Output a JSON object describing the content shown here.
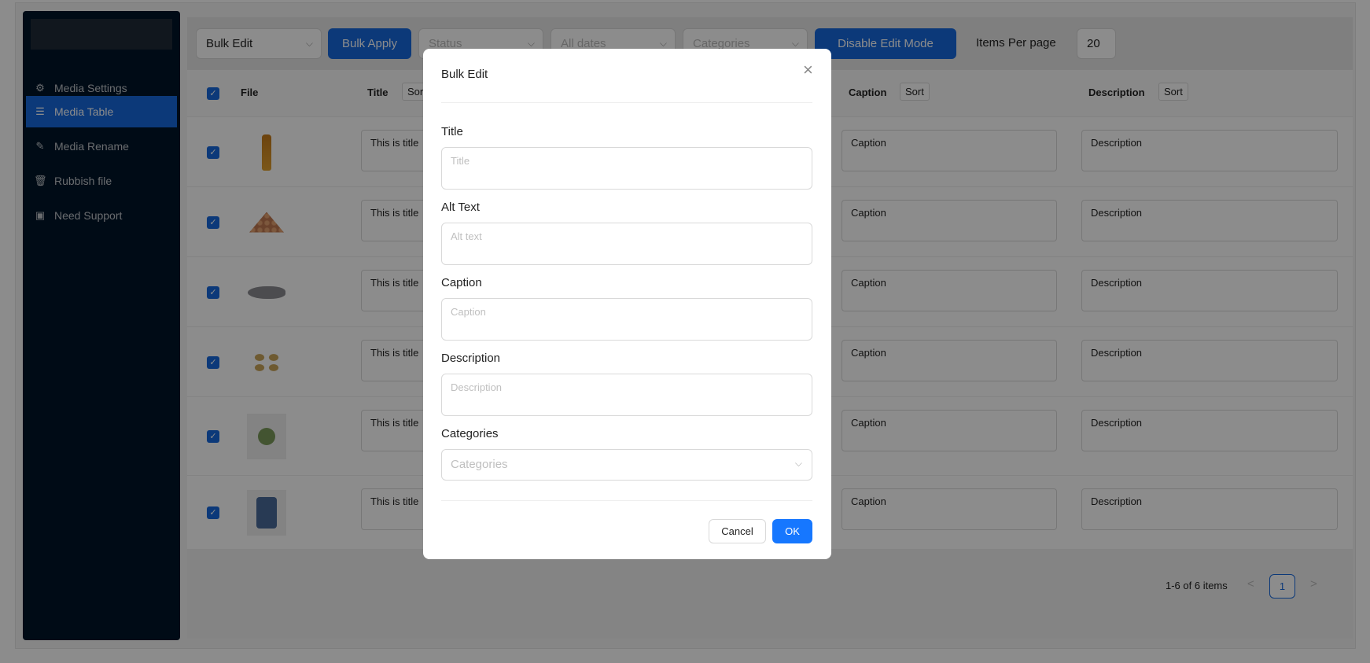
{
  "sidebar": {
    "items": [
      {
        "label": "Media Settings",
        "icon": "gear-icon",
        "active": false
      },
      {
        "label": "Media Table",
        "icon": "list-icon",
        "active": true
      },
      {
        "label": "Media Rename",
        "icon": "pencil-icon",
        "active": false
      },
      {
        "label": "Rubbish file",
        "icon": "trash-icon",
        "active": false
      },
      {
        "label": "Need Support",
        "icon": "support-icon",
        "active": false
      }
    ]
  },
  "toolbar": {
    "bulk_action": "Bulk Edit",
    "bulk_apply": "Bulk Apply",
    "status_placeholder": "Status",
    "dates_placeholder": "All dates",
    "categories_placeholder": "Categories",
    "edit_mode": "Disable Edit Mode",
    "items_per_page_label": "Items Per page",
    "items_per_page": "20"
  },
  "table": {
    "headers": {
      "file": "File",
      "title": "Title",
      "caption": "Caption",
      "description": "Description",
      "sort": "Sort"
    },
    "rows": [
      {
        "file": "bottle",
        "title": "This is title",
        "caption": "Caption",
        "description": "Description"
      },
      {
        "file": "eggs",
        "title": "This is title",
        "caption": "Caption",
        "description": "Description"
      },
      {
        "file": "fish",
        "title": "This is title",
        "caption": "Caption",
        "description": "Description"
      },
      {
        "file": "potatoes",
        "title": "This is title",
        "caption": "Caption",
        "description": "Description"
      },
      {
        "file": "chair",
        "title": "This is title",
        "caption": "Caption",
        "description": "Description"
      },
      {
        "file": "shirt",
        "title": "This is title",
        "caption": "Caption",
        "description": "Description"
      }
    ]
  },
  "pagination": {
    "summary": "1-6 of 6 items",
    "current": "1",
    "prev": "<",
    "next": ">"
  },
  "modal": {
    "title": "Bulk Edit",
    "close": "×",
    "fields": {
      "title": {
        "label": "Title",
        "placeholder": "Title"
      },
      "alt": {
        "label": "Alt Text",
        "placeholder": "Alt text"
      },
      "caption": {
        "label": "Caption",
        "placeholder": "Caption"
      },
      "description": {
        "label": "Description",
        "placeholder": "Description"
      },
      "categories": {
        "label": "Categories",
        "placeholder": "Categories"
      }
    },
    "cancel": "Cancel",
    "ok": "OK"
  },
  "colors": {
    "primary": "#1668dc",
    "sidebar": "#001529"
  }
}
